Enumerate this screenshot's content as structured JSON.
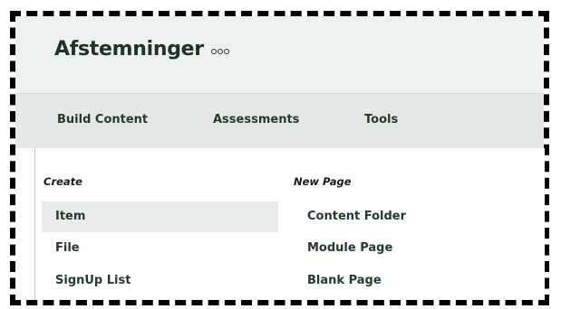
{
  "page": {
    "title": "Afstemninger",
    "more_icon": "more-options-icon"
  },
  "tabs": [
    {
      "label": "Build Content"
    },
    {
      "label": "Assessments"
    },
    {
      "label": "Tools"
    }
  ],
  "menu": {
    "create": {
      "heading": "Create",
      "items": [
        {
          "label": "Item",
          "selected": true
        },
        {
          "label": "File"
        },
        {
          "label": "SignUp List"
        }
      ]
    },
    "new_page": {
      "heading": "New Page",
      "items": [
        {
          "label": "Content Folder"
        },
        {
          "label": "Module Page"
        },
        {
          "label": "Blank Page"
        }
      ]
    }
  },
  "colors": {
    "text": "#243a2c",
    "header_bg": "#eff0f0",
    "tabbar_bg": "#e6e7e7",
    "selected_bg": "#eaebeb"
  }
}
